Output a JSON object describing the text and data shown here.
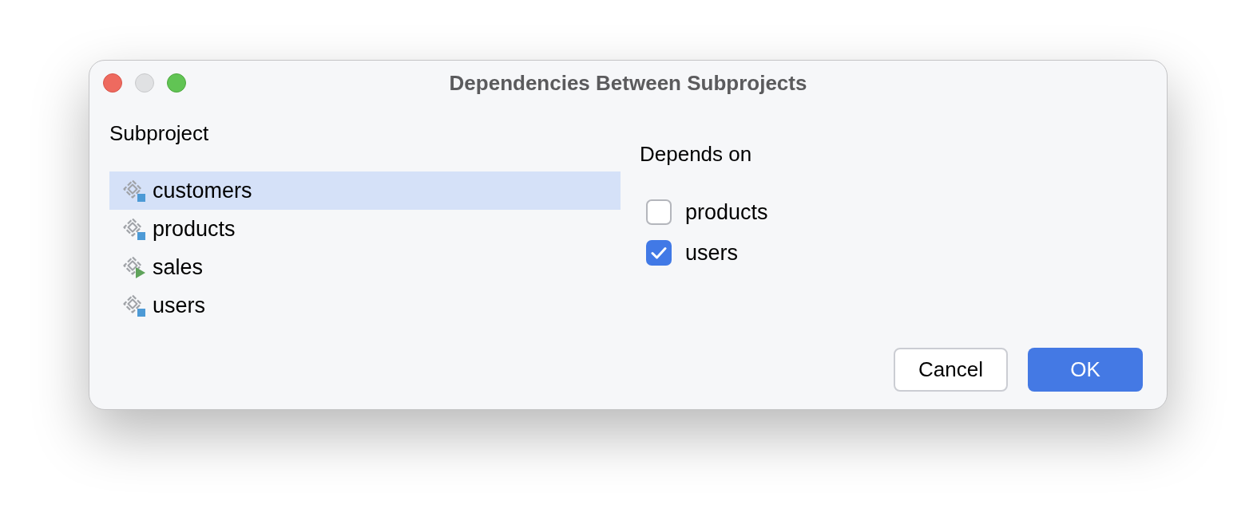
{
  "window": {
    "title": "Dependencies Between Subprojects"
  },
  "subprojects": {
    "heading": "Subproject",
    "items": [
      {
        "name": "customers",
        "kind": "module",
        "selected": true
      },
      {
        "name": "products",
        "kind": "module",
        "selected": false
      },
      {
        "name": "sales",
        "kind": "runnable",
        "selected": false
      },
      {
        "name": "users",
        "kind": "module",
        "selected": false
      }
    ]
  },
  "dependencies": {
    "heading": "Depends on",
    "items": [
      {
        "name": "products",
        "checked": false
      },
      {
        "name": "users",
        "checked": true
      }
    ]
  },
  "buttons": [
    {
      "label": "Cancel",
      "kind": "secondary"
    },
    {
      "label": "OK",
      "kind": "primary"
    }
  ]
}
